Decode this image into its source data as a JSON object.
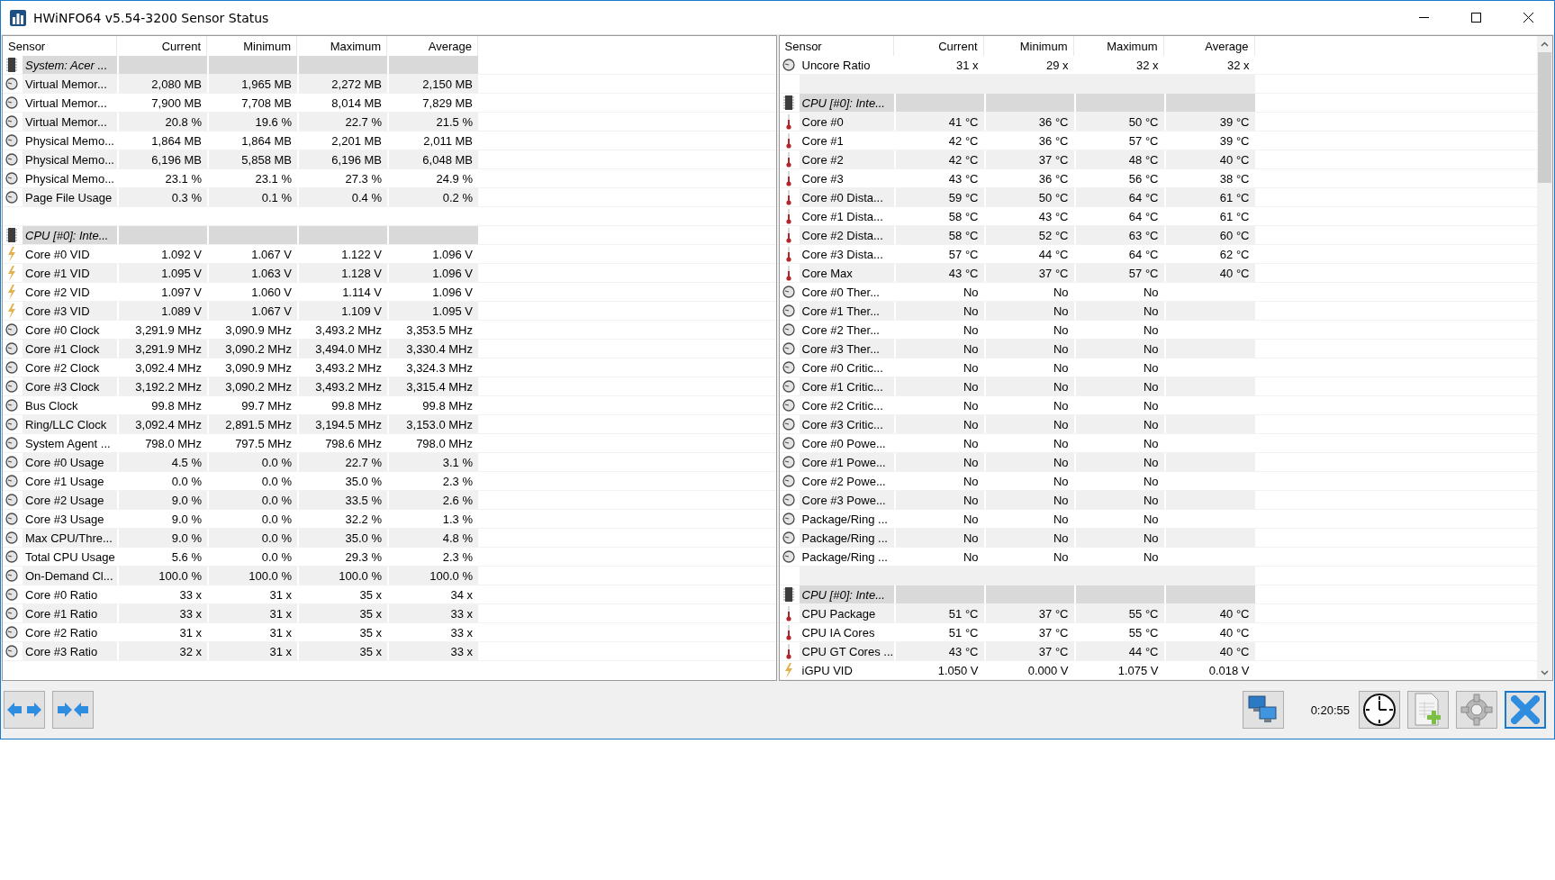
{
  "window": {
    "title": "HWiNFO64 v5.54-3200 Sensor Status"
  },
  "panels": [
    {
      "columns": [
        "Sensor",
        "Current",
        "Minimum",
        "Maximum",
        "Average"
      ],
      "rows": [
        {
          "kind": "group",
          "name": "System: Acer ..."
        },
        {
          "kind": "gauge",
          "name": "Virtual Memor...",
          "values": [
            "2,080 MB",
            "1,965 MB",
            "2,272 MB",
            "2,150 MB"
          ]
        },
        {
          "kind": "gauge",
          "name": "Virtual Memor...",
          "values": [
            "7,900 MB",
            "7,708 MB",
            "8,014 MB",
            "7,829 MB"
          ]
        },
        {
          "kind": "gauge",
          "name": "Virtual Memor...",
          "values": [
            "20.8 %",
            "19.6 %",
            "22.7 %",
            "21.5 %"
          ]
        },
        {
          "kind": "gauge",
          "name": "Physical Memo...",
          "values": [
            "1,864 MB",
            "1,864 MB",
            "2,201 MB",
            "2,011 MB"
          ]
        },
        {
          "kind": "gauge",
          "name": "Physical Memo...",
          "values": [
            "6,196 MB",
            "5,858 MB",
            "6,196 MB",
            "6,048 MB"
          ]
        },
        {
          "kind": "gauge",
          "name": "Physical Memo...",
          "values": [
            "23.1 %",
            "23.1 %",
            "27.3 %",
            "24.9 %"
          ]
        },
        {
          "kind": "gauge",
          "name": "Page File Usage",
          "values": [
            "0.3 %",
            "0.1 %",
            "0.4 %",
            "0.2 %"
          ]
        },
        {
          "kind": "blank"
        },
        {
          "kind": "group",
          "name": "CPU [#0]: Inte..."
        },
        {
          "kind": "bolt",
          "name": "Core #0 VID",
          "values": [
            "1.092 V",
            "1.067 V",
            "1.122 V",
            "1.096 V"
          ]
        },
        {
          "kind": "bolt",
          "name": "Core #1 VID",
          "values": [
            "1.095 V",
            "1.063 V",
            "1.128 V",
            "1.096 V"
          ]
        },
        {
          "kind": "bolt",
          "name": "Core #2 VID",
          "values": [
            "1.097 V",
            "1.060 V",
            "1.114 V",
            "1.096 V"
          ]
        },
        {
          "kind": "bolt",
          "name": "Core #3 VID",
          "values": [
            "1.089 V",
            "1.067 V",
            "1.109 V",
            "1.095 V"
          ]
        },
        {
          "kind": "gauge",
          "name": "Core #0 Clock",
          "values": [
            "3,291.9 MHz",
            "3,090.9 MHz",
            "3,493.2 MHz",
            "3,353.5 MHz"
          ]
        },
        {
          "kind": "gauge",
          "name": "Core #1 Clock",
          "values": [
            "3,291.9 MHz",
            "3,090.2 MHz",
            "3,494.0 MHz",
            "3,330.4 MHz"
          ]
        },
        {
          "kind": "gauge",
          "name": "Core #2 Clock",
          "values": [
            "3,092.4 MHz",
            "3,090.9 MHz",
            "3,493.2 MHz",
            "3,324.3 MHz"
          ]
        },
        {
          "kind": "gauge",
          "name": "Core #3 Clock",
          "values": [
            "3,192.2 MHz",
            "3,090.2 MHz",
            "3,493.2 MHz",
            "3,315.4 MHz"
          ]
        },
        {
          "kind": "gauge",
          "name": "Bus Clock",
          "values": [
            "99.8 MHz",
            "99.7 MHz",
            "99.8 MHz",
            "99.8 MHz"
          ]
        },
        {
          "kind": "gauge",
          "name": "Ring/LLC Clock",
          "values": [
            "3,092.4 MHz",
            "2,891.5 MHz",
            "3,194.5 MHz",
            "3,153.0 MHz"
          ]
        },
        {
          "kind": "gauge",
          "name": "System Agent ...",
          "values": [
            "798.0 MHz",
            "797.5 MHz",
            "798.6 MHz",
            "798.0 MHz"
          ]
        },
        {
          "kind": "gauge",
          "name": "Core #0 Usage",
          "values": [
            "4.5 %",
            "0.0 %",
            "22.7 %",
            "3.1 %"
          ]
        },
        {
          "kind": "gauge",
          "name": "Core #1 Usage",
          "values": [
            "0.0 %",
            "0.0 %",
            "35.0 %",
            "2.3 %"
          ]
        },
        {
          "kind": "gauge",
          "name": "Core #2 Usage",
          "values": [
            "9.0 %",
            "0.0 %",
            "33.5 %",
            "2.6 %"
          ]
        },
        {
          "kind": "gauge",
          "name": "Core #3 Usage",
          "values": [
            "9.0 %",
            "0.0 %",
            "32.2 %",
            "1.3 %"
          ]
        },
        {
          "kind": "gauge",
          "name": "Max CPU/Thre...",
          "values": [
            "9.0 %",
            "0.0 %",
            "35.0 %",
            "4.8 %"
          ]
        },
        {
          "kind": "gauge",
          "name": "Total CPU Usage",
          "values": [
            "5.6 %",
            "0.0 %",
            "29.3 %",
            "2.3 %"
          ]
        },
        {
          "kind": "gauge",
          "name": "On-Demand Cl...",
          "values": [
            "100.0 %",
            "100.0 %",
            "100.0 %",
            "100.0 %"
          ]
        },
        {
          "kind": "gauge",
          "name": "Core #0 Ratio",
          "values": [
            "33 x",
            "31 x",
            "35 x",
            "34 x"
          ]
        },
        {
          "kind": "gauge",
          "name": "Core #1 Ratio",
          "values": [
            "33 x",
            "31 x",
            "35 x",
            "33 x"
          ]
        },
        {
          "kind": "gauge",
          "name": "Core #2 Ratio",
          "values": [
            "31 x",
            "31 x",
            "35 x",
            "33 x"
          ]
        },
        {
          "kind": "gauge",
          "name": "Core #3 Ratio",
          "values": [
            "32 x",
            "31 x",
            "35 x",
            "33 x"
          ]
        }
      ]
    },
    {
      "columns": [
        "Sensor",
        "Current",
        "Minimum",
        "Maximum",
        "Average"
      ],
      "rows": [
        {
          "kind": "gauge",
          "name": "Uncore Ratio",
          "values": [
            "31 x",
            "29 x",
            "32 x",
            "32 x"
          ]
        },
        {
          "kind": "blank"
        },
        {
          "kind": "group",
          "name": "CPU [#0]: Inte..."
        },
        {
          "kind": "thermometer",
          "name": "Core #0",
          "values": [
            "41 °C",
            "36 °C",
            "50 °C",
            "39 °C"
          ]
        },
        {
          "kind": "thermometer",
          "name": "Core #1",
          "values": [
            "42 °C",
            "36 °C",
            "57 °C",
            "39 °C"
          ]
        },
        {
          "kind": "thermometer",
          "name": "Core #2",
          "values": [
            "42 °C",
            "37 °C",
            "48 °C",
            "40 °C"
          ]
        },
        {
          "kind": "thermometer",
          "name": "Core #3",
          "values": [
            "43 °C",
            "36 °C",
            "56 °C",
            "38 °C"
          ]
        },
        {
          "kind": "thermometer",
          "name": "Core #0 Dista...",
          "values": [
            "59 °C",
            "50 °C",
            "64 °C",
            "61 °C"
          ]
        },
        {
          "kind": "thermometer",
          "name": "Core #1 Dista...",
          "values": [
            "58 °C",
            "43 °C",
            "64 °C",
            "61 °C"
          ]
        },
        {
          "kind": "thermometer",
          "name": "Core #2 Dista...",
          "values": [
            "58 °C",
            "52 °C",
            "63 °C",
            "60 °C"
          ]
        },
        {
          "kind": "thermometer",
          "name": "Core #3 Dista...",
          "values": [
            "57 °C",
            "44 °C",
            "64 °C",
            "62 °C"
          ]
        },
        {
          "kind": "thermometer",
          "name": "Core Max",
          "values": [
            "43 °C",
            "37 °C",
            "57 °C",
            "40 °C"
          ]
        },
        {
          "kind": "gauge",
          "name": "Core #0 Ther...",
          "values": [
            "No",
            "No",
            "No"
          ]
        },
        {
          "kind": "gauge",
          "name": "Core #1 Ther...",
          "values": [
            "No",
            "No",
            "No"
          ]
        },
        {
          "kind": "gauge",
          "name": "Core #2 Ther...",
          "values": [
            "No",
            "No",
            "No"
          ]
        },
        {
          "kind": "gauge",
          "name": "Core #3 Ther...",
          "values": [
            "No",
            "No",
            "No"
          ]
        },
        {
          "kind": "gauge",
          "name": "Core #0 Critic...",
          "values": [
            "No",
            "No",
            "No"
          ]
        },
        {
          "kind": "gauge",
          "name": "Core #1 Critic...",
          "values": [
            "No",
            "No",
            "No"
          ]
        },
        {
          "kind": "gauge",
          "name": "Core #2 Critic...",
          "values": [
            "No",
            "No",
            "No"
          ]
        },
        {
          "kind": "gauge",
          "name": "Core #3 Critic...",
          "values": [
            "No",
            "No",
            "No"
          ]
        },
        {
          "kind": "gauge",
          "name": "Core #0 Powe...",
          "values": [
            "No",
            "No",
            "No"
          ]
        },
        {
          "kind": "gauge",
          "name": "Core #1 Powe...",
          "values": [
            "No",
            "No",
            "No"
          ]
        },
        {
          "kind": "gauge",
          "name": "Core #2 Powe...",
          "values": [
            "No",
            "No",
            "No"
          ]
        },
        {
          "kind": "gauge",
          "name": "Core #3 Powe...",
          "values": [
            "No",
            "No",
            "No"
          ]
        },
        {
          "kind": "gauge",
          "name": "Package/Ring ...",
          "values": [
            "No",
            "No",
            "No"
          ]
        },
        {
          "kind": "gauge",
          "name": "Package/Ring ...",
          "values": [
            "No",
            "No",
            "No"
          ]
        },
        {
          "kind": "gauge",
          "name": "Package/Ring ...",
          "values": [
            "No",
            "No",
            "No"
          ]
        },
        {
          "kind": "blank"
        },
        {
          "kind": "group",
          "name": "CPU [#0]: Inte..."
        },
        {
          "kind": "thermometer",
          "name": "CPU Package",
          "values": [
            "51 °C",
            "37 °C",
            "55 °C",
            "40 °C"
          ]
        },
        {
          "kind": "thermometer",
          "name": "CPU IA Cores",
          "values": [
            "51 °C",
            "37 °C",
            "55 °C",
            "40 °C"
          ]
        },
        {
          "kind": "thermometer",
          "name": "CPU GT Cores ...",
          "values": [
            "43 °C",
            "37 °C",
            "44 °C",
            "40 °C"
          ]
        },
        {
          "kind": "bolt",
          "name": "iGPU VID",
          "values": [
            "1.050 V",
            "0.000 V",
            "1.075 V",
            "0.018 V"
          ]
        }
      ]
    }
  ],
  "toolbar": {
    "left_buttons": [
      {
        "kind": "expand",
        "focused": false
      },
      {
        "kind": "collapse",
        "focused": false
      }
    ],
    "right_buttons": [
      {
        "kind": "network",
        "focused": false
      },
      {
        "kind": "timer",
        "focused": false
      },
      {
        "kind": "report",
        "focused": false
      },
      {
        "kind": "settings",
        "focused": false
      },
      {
        "kind": "close",
        "focused": true
      }
    ],
    "elapsed": "0:20:55"
  }
}
